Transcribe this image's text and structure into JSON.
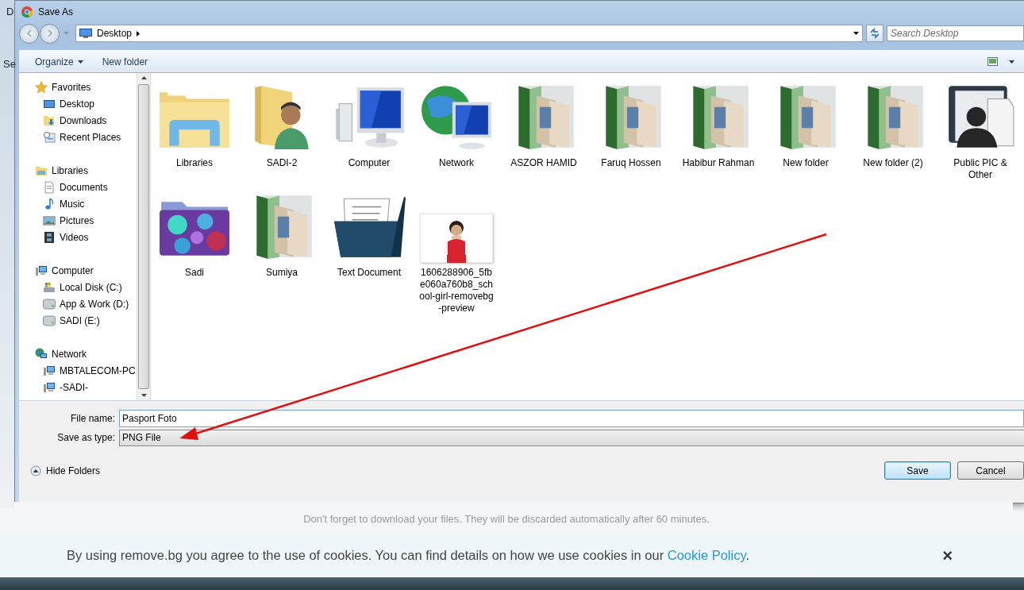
{
  "background_page": {
    "fragments": [
      "D",
      "Se"
    ],
    "notice": "Don't forget to download your files. They will be discarded automatically after 60 minutes.",
    "cookie_banner": {
      "text": "By using remove.bg you agree to the use of cookies. You can find details on how we use cookies in our ",
      "link": "Cookie Policy",
      "trailing": ".",
      "close": "×"
    }
  },
  "window": {
    "title": "Save As"
  },
  "address_bar": {
    "path": "Desktop",
    "search_placeholder": "Search Desktop"
  },
  "toolbar": {
    "organize": "Organize",
    "new_folder": "New folder"
  },
  "nav": [
    {
      "label": "Favorites",
      "kind": "star",
      "children": [
        {
          "label": "Desktop",
          "kind": "desktop"
        },
        {
          "label": "Downloads",
          "kind": "downloads"
        },
        {
          "label": "Recent Places",
          "kind": "recent"
        }
      ]
    },
    {
      "label": "Libraries",
      "kind": "library",
      "children": [
        {
          "label": "Documents",
          "kind": "document"
        },
        {
          "label": "Music",
          "kind": "music"
        },
        {
          "label": "Pictures",
          "kind": "pictures"
        },
        {
          "label": "Videos",
          "kind": "videos"
        }
      ]
    },
    {
      "label": "Computer",
      "kind": "computer",
      "children": [
        {
          "label": "Local Disk (C:)",
          "kind": "system-disk"
        },
        {
          "label": "App & Work (D:)",
          "kind": "disk"
        },
        {
          "label": "SADI (E:)",
          "kind": "disk"
        }
      ]
    },
    {
      "label": "Network",
      "kind": "network",
      "children": [
        {
          "label": "MBTALECOM-PC",
          "kind": "computer"
        },
        {
          "label": "-SADI-",
          "kind": "computer"
        }
      ]
    }
  ],
  "files": [
    {
      "name": "Libraries",
      "kind": "libraries"
    },
    {
      "name": "SADI-2",
      "kind": "user-folder"
    },
    {
      "name": "Computer",
      "kind": "computer"
    },
    {
      "name": "Network",
      "kind": "network"
    },
    {
      "name": "ASZOR HAMID",
      "kind": "photo-folder"
    },
    {
      "name": "Faruq Hossen",
      "kind": "photo-folder"
    },
    {
      "name": "Habibur Rahman",
      "kind": "photo-folder"
    },
    {
      "name": "New folder",
      "kind": "photo-folder"
    },
    {
      "name": "New folder (2)",
      "kind": "photo-folder"
    },
    {
      "name": "Public PIC & Other",
      "kind": "contact-folder"
    },
    {
      "name": "Sadi",
      "kind": "art-folder"
    },
    {
      "name": "Sumiya",
      "kind": "photo-folder"
    },
    {
      "name": "Text Document",
      "kind": "document-folder"
    },
    {
      "name": "1606288906_5fbe060a760b8_school-girl-removebg-preview",
      "kind": "picture"
    }
  ],
  "form": {
    "file_name_label": "File name:",
    "file_name": "Pasport Foto",
    "type_label": "Save as type:",
    "type": "PNG File"
  },
  "hide_folders": "Hide Folders",
  "buttons": [
    {
      "label": "Save",
      "selected": true
    },
    {
      "label": "Cancel",
      "selected": false
    }
  ]
}
